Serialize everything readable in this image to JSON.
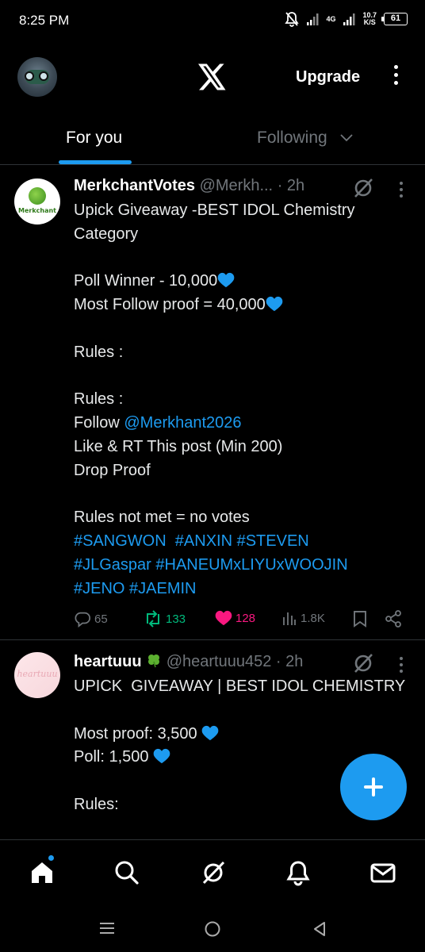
{
  "status_bar": {
    "time": "8:25 PM",
    "network": "4G",
    "speed_value": "10.7",
    "speed_unit": "K/S",
    "battery": "61"
  },
  "header": {
    "logo": "x-logo",
    "upgrade_label": "Upgrade"
  },
  "tabs": [
    {
      "label": "For you",
      "active": true
    },
    {
      "label": "Following",
      "active": false
    }
  ],
  "posts": [
    {
      "avatar_text": "Merkchant",
      "name": "MerkchantVotes",
      "handle": "@Merkh...",
      "time": "· 2h",
      "lines": {
        "l1": "Upick Giveaway -BEST IDOL Chemistry Category",
        "l2": "Poll Winner - 10,000",
        "l3": "Most Follow proof = 40,000",
        "l4": "Rules :",
        "l5": "Rules :",
        "l6_prefix": "Follow ",
        "l6_mention": "@Merkhant2026",
        "l7": "Like & RT This post (Min 200)",
        "l8": "Drop Proof",
        "l9": "Rules not met = no votes",
        "tags1": "#SANGWON  #ANXIN #STEVEN",
        "tags2": "#JLGaspar #HANEUMxLIYUxWOOJIN",
        "tags3": "#JENO #JAEMIN"
      },
      "stats": {
        "replies": "65",
        "reposts": "133",
        "likes": "128",
        "views": "1.8K"
      }
    },
    {
      "avatar_text": "heartuuu",
      "name": "heartuuu",
      "handle": "@heartuuu452",
      "time": "· 2h",
      "lines": {
        "l1": "UPICK  GIVEAWAY | BEST IDOL CHEMISTRY",
        "l2": "Most proof: 3,500",
        "l3": "Poll: 1,500",
        "l4": "Rules:"
      }
    }
  ],
  "colors": {
    "accent": "#1d9bf0",
    "repost": "#00ba7c",
    "like": "#f91880",
    "muted": "#71767b"
  }
}
